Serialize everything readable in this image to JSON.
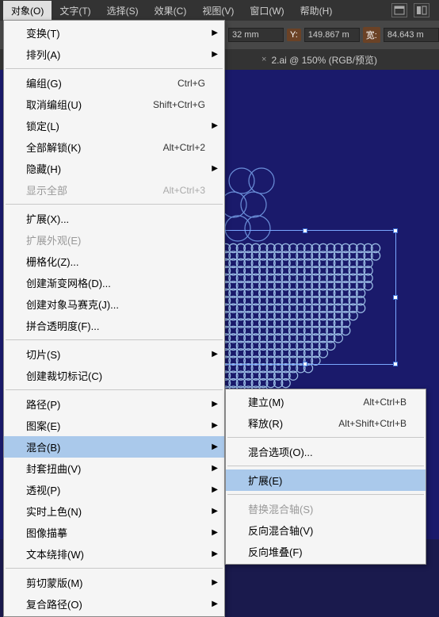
{
  "menubar": {
    "items": [
      "对象(O)",
      "文字(T)",
      "选择(S)",
      "效果(C)",
      "视图(V)",
      "窗口(W)",
      "帮助(H)"
    ],
    "active_index": 0
  },
  "controlbar": {
    "x_suffix": "32 mm",
    "y_label": "Y:",
    "y_value": "149.867 m",
    "w_label": "宽:",
    "w_value": "84.643 m"
  },
  "tab": {
    "title": "2.ai @ 150% (RGB/预览)"
  },
  "main_menu": [
    {
      "type": "item",
      "label": "变换(T)",
      "arrow": true
    },
    {
      "type": "item",
      "label": "排列(A)",
      "arrow": true
    },
    {
      "type": "sep"
    },
    {
      "type": "item",
      "label": "编组(G)",
      "shortcut": "Ctrl+G"
    },
    {
      "type": "item",
      "label": "取消编组(U)",
      "shortcut": "Shift+Ctrl+G"
    },
    {
      "type": "item",
      "label": "锁定(L)",
      "arrow": true
    },
    {
      "type": "item",
      "label": "全部解锁(K)",
      "shortcut": "Alt+Ctrl+2"
    },
    {
      "type": "item",
      "label": "隐藏(H)",
      "arrow": true
    },
    {
      "type": "item",
      "label": "显示全部",
      "shortcut": "Alt+Ctrl+3",
      "disabled": true
    },
    {
      "type": "sep"
    },
    {
      "type": "item",
      "label": "扩展(X)..."
    },
    {
      "type": "item",
      "label": "扩展外观(E)",
      "disabled": true
    },
    {
      "type": "item",
      "label": "栅格化(Z)..."
    },
    {
      "type": "item",
      "label": "创建渐变网格(D)..."
    },
    {
      "type": "item",
      "label": "创建对象马赛克(J)..."
    },
    {
      "type": "item",
      "label": "拼合透明度(F)..."
    },
    {
      "type": "sep"
    },
    {
      "type": "item",
      "label": "切片(S)",
      "arrow": true
    },
    {
      "type": "item",
      "label": "创建裁切标记(C)"
    },
    {
      "type": "sep"
    },
    {
      "type": "item",
      "label": "路径(P)",
      "arrow": true
    },
    {
      "type": "item",
      "label": "图案(E)",
      "arrow": true
    },
    {
      "type": "item",
      "label": "混合(B)",
      "arrow": true,
      "highlight": true
    },
    {
      "type": "item",
      "label": "封套扭曲(V)",
      "arrow": true
    },
    {
      "type": "item",
      "label": "透视(P)",
      "arrow": true
    },
    {
      "type": "item",
      "label": "实时上色(N)",
      "arrow": true
    },
    {
      "type": "item",
      "label": "图像描摹",
      "arrow": true
    },
    {
      "type": "item",
      "label": "文本绕排(W)",
      "arrow": true
    },
    {
      "type": "sep"
    },
    {
      "type": "item",
      "label": "剪切蒙版(M)",
      "arrow": true
    },
    {
      "type": "item",
      "label": "复合路径(O)",
      "arrow": true
    }
  ],
  "sub_menu": [
    {
      "type": "item",
      "label": "建立(M)",
      "shortcut": "Alt+Ctrl+B"
    },
    {
      "type": "item",
      "label": "释放(R)",
      "shortcut": "Alt+Shift+Ctrl+B"
    },
    {
      "type": "sep"
    },
    {
      "type": "item",
      "label": "混合选项(O)..."
    },
    {
      "type": "sep"
    },
    {
      "type": "item",
      "label": "扩展(E)",
      "highlight": true
    },
    {
      "type": "sep"
    },
    {
      "type": "item",
      "label": "替换混合轴(S)",
      "disabled": true
    },
    {
      "type": "item",
      "label": "反向混合轴(V)"
    },
    {
      "type": "item",
      "label": "反向堆叠(F)"
    }
  ]
}
